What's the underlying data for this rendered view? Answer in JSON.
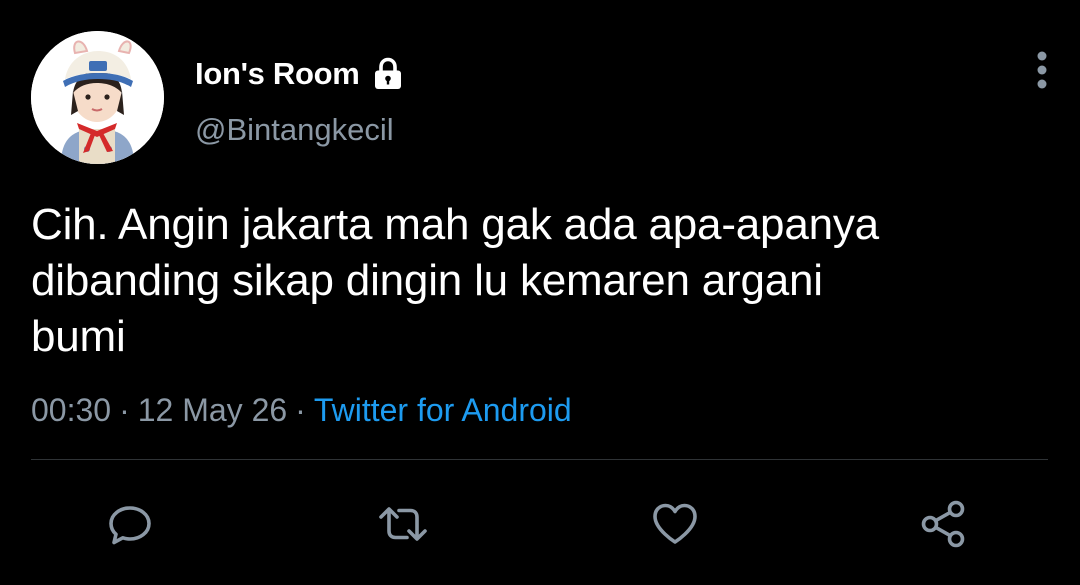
{
  "author": {
    "display_name": "Ion's Room",
    "handle": "@Bintangkecil",
    "protected_icon": "lock-icon",
    "avatar": "avatar-photo"
  },
  "tweet": {
    "text": "Cih. Angin jakarta mah gak ada apa-apanya\ndibanding sikap dingin lu kemaren argani\nbumi",
    "time": "00:30",
    "separator": "·",
    "date": "12 May 26",
    "source": "Twitter for Android"
  },
  "actions": [
    {
      "name": "reply",
      "icon": "reply-icon"
    },
    {
      "name": "retweet",
      "icon": "retweet-icon"
    },
    {
      "name": "like",
      "icon": "heart-icon"
    },
    {
      "name": "share",
      "icon": "share-icon"
    }
  ],
  "menu": {
    "icon": "more-vertical-icon"
  },
  "colors": {
    "background": "#000000",
    "primary_text": "#ffffff",
    "secondary_text": "#8b98a5",
    "link": "#1d9bf0",
    "divider": "#2f3336"
  }
}
